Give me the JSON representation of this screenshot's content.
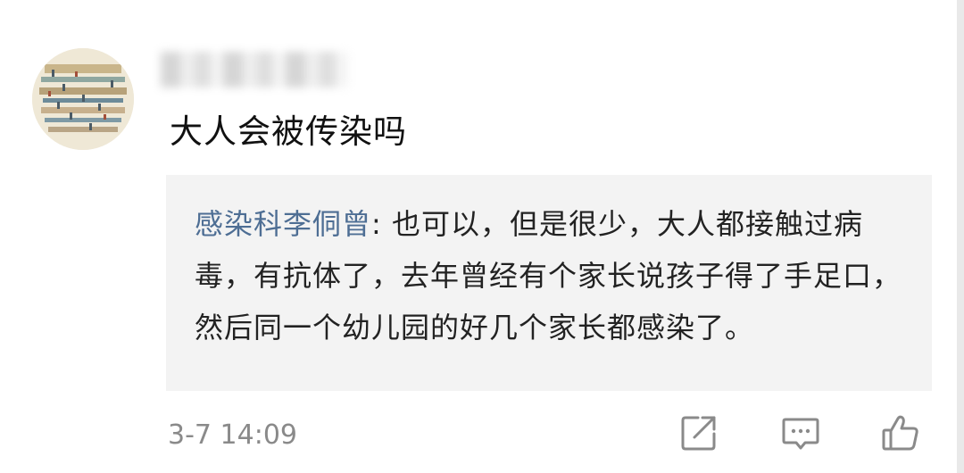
{
  "comment": {
    "author_display": "",
    "text": "大人会被传染吗",
    "timestamp": "3-7 14:09"
  },
  "reply": {
    "author": "感染科李侗曾",
    "separator": ": ",
    "text": "也可以，但是很少，大人都接触过病毒，有抗体了，去年曾经有个家长说孩子得了手足口，然后同一个幼儿园的好几个家长都感染了。"
  },
  "actions": {
    "icons": [
      "share-icon",
      "comment-icon",
      "like-icon"
    ]
  },
  "colors": {
    "author_link": "#4e6e94",
    "reply_bg": "#f3f3f3",
    "icon": "#8a8a8a"
  }
}
